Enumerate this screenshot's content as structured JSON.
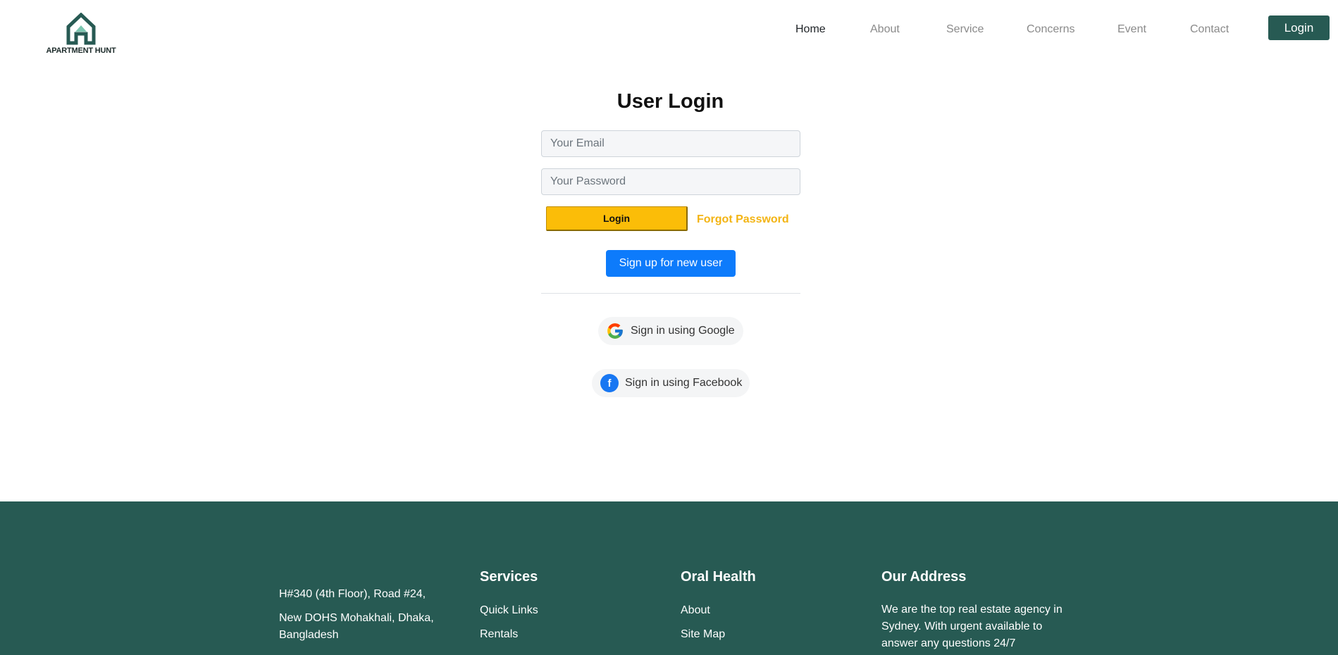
{
  "header": {
    "logo_text": "APARTMENT HUNT",
    "nav": [
      "Home",
      "About",
      "Service",
      "Concerns",
      "Event",
      "Contact"
    ],
    "login_label": "Login"
  },
  "form": {
    "title": "User Login",
    "email_placeholder": "Your Email",
    "password_placeholder": "Your Password",
    "login_label": "Login",
    "forgot_label": "Forgot Password",
    "signup_label": "Sign up for new user",
    "google_label": "Sign in using Google",
    "facebook_label": "Sign in using Facebook"
  },
  "footer": {
    "address_line1": "H#340 (4th Floor), Road #24,",
    "address_line2": "New DOHS Mohakhali, Dhaka, Bangladesh",
    "col1_title": "Services",
    "col1_links": [
      "Quick Links",
      "Rentals"
    ],
    "col2_title": "Oral Health",
    "col2_links": [
      "About",
      "Site Map"
    ],
    "col3_title": "Our Address",
    "col3_text": "We are the top real estate agency in Sydney. With urgent available to answer any questions 24/7"
  },
  "colors": {
    "brand_green": "#275a53",
    "accent_yellow": "#fbbd08",
    "primary_blue": "#0d7bfb"
  }
}
